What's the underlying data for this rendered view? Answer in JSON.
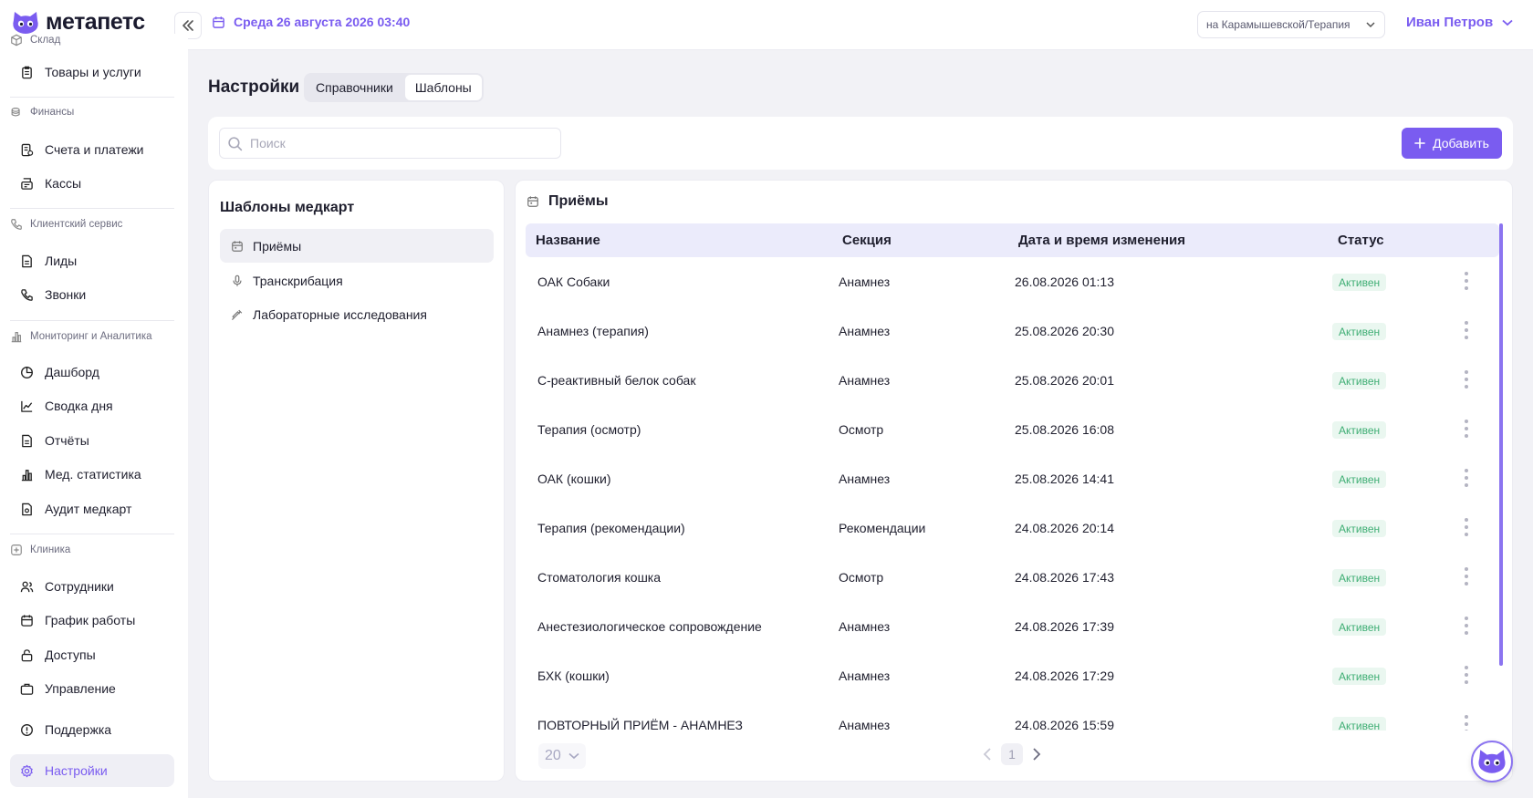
{
  "app": {
    "logo_text": "метапетс"
  },
  "header": {
    "date": "Среда 26 августа 2026 03:40",
    "branch": "на Карамышевской/Терапия",
    "user": "Иван Петров"
  },
  "sidebar": {
    "sections": [
      {
        "title": "Склад",
        "icon": "box-icon",
        "items": [
          {
            "label": "Товары и услуги",
            "icon": "clipboard-icon"
          }
        ]
      },
      {
        "title": "Финансы",
        "icon": "coins-icon",
        "items": [
          {
            "label": "Счета и платежи",
            "icon": "invoice-icon"
          },
          {
            "label": "Кассы",
            "icon": "register-icon"
          }
        ]
      },
      {
        "title": "Клиентский сервис",
        "icon": "phone-icon",
        "items": [
          {
            "label": "Лиды",
            "icon": "document-icon"
          },
          {
            "label": "Звонки",
            "icon": "phone-icon"
          }
        ]
      },
      {
        "title": "Мониторинг и Аналитика",
        "icon": "bar-chart-icon",
        "items": [
          {
            "label": "Дашборд",
            "icon": "pie-icon"
          },
          {
            "label": "Сводка дня",
            "icon": "line-chart-icon"
          },
          {
            "label": "Отчёты",
            "icon": "document-icon"
          },
          {
            "label": "Мед. статистика",
            "icon": "bar-chart-icon"
          },
          {
            "label": "Аудит медкарт",
            "icon": "document-icon"
          }
        ]
      },
      {
        "title": "Клиника",
        "icon": "clinic-icon",
        "items": [
          {
            "label": "Сотрудники",
            "icon": "users-icon"
          },
          {
            "label": "График работы",
            "icon": "calendar-icon"
          },
          {
            "label": "Доступы",
            "icon": "lock-icon"
          },
          {
            "label": "Управление",
            "icon": "briefcase-icon"
          }
        ]
      }
    ],
    "support": "Поддержка",
    "settings": "Настройки"
  },
  "page": {
    "title": "Настройки",
    "tabs": [
      {
        "label": "Справочники",
        "active": false
      },
      {
        "label": "Шаблоны",
        "active": true
      }
    ]
  },
  "toolbar": {
    "search_placeholder": "Поиск",
    "add_label": "Добавить"
  },
  "templates_panel": {
    "title": "Шаблоны медкарт",
    "categories": [
      {
        "label": "Приёмы",
        "icon": "calendar-icon",
        "active": true
      },
      {
        "label": "Транскрибация",
        "icon": "microphone-icon",
        "active": false
      },
      {
        "label": "Лабораторные исследования",
        "icon": "pipette-icon",
        "active": false
      }
    ]
  },
  "table": {
    "title": "Приёмы",
    "columns": [
      "Название",
      "Секция",
      "Дата и время изменения",
      "Статус"
    ],
    "rows": [
      {
        "name": "ОАК Собаки",
        "section": "Анамнез",
        "date": "26.08.2026 01:13",
        "status": "Активен"
      },
      {
        "name": "Анамнез (терапия)",
        "section": "Анамнез",
        "date": "25.08.2026 20:30",
        "status": "Активен"
      },
      {
        "name": "С-реактивный белок собак",
        "section": "Анамнез",
        "date": "25.08.2026 20:01",
        "status": "Активен"
      },
      {
        "name": "Терапия (осмотр)",
        "section": "Осмотр",
        "date": "25.08.2026 16:08",
        "status": "Активен"
      },
      {
        "name": "ОАК (кошки)",
        "section": "Анамнез",
        "date": "25.08.2026 14:41",
        "status": "Активен"
      },
      {
        "name": "Терапия (рекомендации)",
        "section": "Рекомендации",
        "date": "24.08.2026 20:14",
        "status": "Активен"
      },
      {
        "name": "Стоматология кошка",
        "section": "Осмотр",
        "date": "24.08.2026 17:43",
        "status": "Активен"
      },
      {
        "name": "Анестезиологическое сопровождение",
        "section": "Анамнез",
        "date": "24.08.2026 17:39",
        "status": "Активен"
      },
      {
        "name": "БХК (кошки)",
        "section": "Анамнез",
        "date": "24.08.2026 17:29",
        "status": "Активен"
      },
      {
        "name": "ПОВТОРНЫЙ ПРИЁМ - АНАМНЕЗ",
        "section": "Анамнез",
        "date": "24.08.2026 15:59",
        "status": "Активен"
      }
    ]
  },
  "pagination": {
    "page_size": "20",
    "current_page": "1"
  },
  "colors": {
    "accent": "#7a5cf0",
    "status_bg": "#eaf7f0",
    "status_text": "#3fae74",
    "header_row": "#ebebfb"
  }
}
